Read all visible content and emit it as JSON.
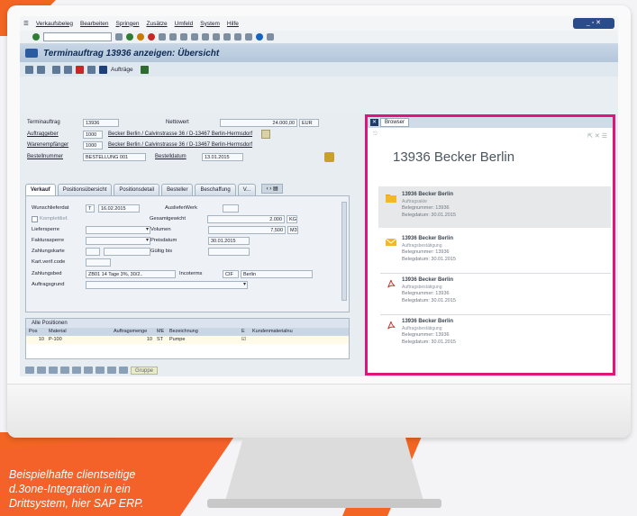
{
  "sap": {
    "menu": [
      "Verkaufsbeleg",
      "Bearbeiten",
      "Springen",
      "Zusätze",
      "Umfeld",
      "System",
      "Hilfe"
    ],
    "title": "Terminauftrag 13936 anzeigen: Übersicht",
    "toolbar2_label": "Aufträge",
    "header": {
      "terminauftrag_label": "Terminauftrag",
      "terminauftrag_value": "13936",
      "nettowert_label": "Nettowert",
      "nettowert_value": "24.000,00",
      "currency": "EUR",
      "auftraggeber_label": "Auftraggeber",
      "auftraggeber_value": "1000",
      "auftraggeber_addr": "Becker Berlin / Calvinstrasse 36 / D-13467 Berlin-Hermsdorf",
      "warenempfaenger_label": "Warenempfänger",
      "warenempfaenger_value": "1000",
      "warenempfaenger_addr": "Becker Berlin / Calvinstrasse 36 / D-13467 Berlin-Hermsdorf",
      "bestellnummer_label": "Bestellnummer",
      "bestellnummer_value": "BESTELLUNG 001",
      "bestelldatum_label": "Bestelldatum",
      "bestelldatum_value": "13.01.2015"
    },
    "tabs": [
      "Verkauf",
      "Positionsübersicht",
      "Positionsdetail",
      "Besteller",
      "Beschaffung",
      "V..."
    ],
    "fields": {
      "wunschlieferdat_label": "Wunschlieferdat",
      "wunschlieferdat_type": "T",
      "wunschlieferdat_value": "16.02.2015",
      "auslieferwerk_label": "AuslieferWerk",
      "komplettlief_label": "Komplettlief.",
      "gesamtgewicht_label": "Gesamtgewicht",
      "gesamtgewicht_value": "2.000",
      "gesamtgewicht_unit": "KG",
      "liefersperre_label": "Liefersperre",
      "volumen_label": "Volumen",
      "volumen_value": "7,500",
      "volumen_unit": "M3",
      "fakturasperre_label": "Fakturasperre",
      "preisdatum_label": "Preisdatum",
      "preisdatum_value": "30.01.2015",
      "zahlungskarte_label": "Zahlungskarte",
      "gueltig_bis_label": "Gültig bis",
      "kartverifcode_label": "Kart.verif.code",
      "zahlungsbed_label": "Zahlungsbed",
      "zahlungsbed_value": "ZB01 14 Tage 3%, 30/2..",
      "incoterms_label": "Incoterms",
      "incoterms_code": "CIF",
      "incoterms_place": "Berlin",
      "auftragsgrund_label": "Auftragsgrund"
    },
    "positions": {
      "title": "Alle Positionen",
      "columns": [
        "Pos",
        "Material",
        "Auftragsmenge",
        "ME",
        "Bezeichnung",
        "E",
        "Kundenmaterialnu"
      ],
      "rows": [
        {
          "pos": "10",
          "material": "P-100",
          "menge": "10",
          "me": "ST",
          "bezeichnung": "Pumpe"
        }
      ]
    },
    "bottom_button": "Gruppe"
  },
  "d3one": {
    "tab_label": "Browser",
    "heading": "13936 Becker Berlin",
    "items": [
      {
        "icon": "folder-icon",
        "title": "13936 Becker Berlin",
        "subtitle": "Auftragsakte",
        "belegnummer": "Belegnummer: 13936",
        "belegdatum": "Belegdatum: 30.01.2015"
      },
      {
        "icon": "mail-icon",
        "title": "13936 Becker Berlin",
        "subtitle": "Auftragsbestätigung",
        "belegnummer": "Belegnummer: 13936",
        "belegdatum": "Belegdatum: 30.01.2015"
      },
      {
        "icon": "pdf-icon",
        "title": "13936 Becker Berlin",
        "subtitle": "Auftragsbestätigung",
        "belegnummer": "Belegnummer: 13936",
        "belegdatum": "Belegdatum: 30.01.2015"
      },
      {
        "icon": "pdf-icon",
        "title": "13936 Becker Berlin",
        "subtitle": "Auftragsbestätigung",
        "belegnummer": "Belegnummer: 13936",
        "belegdatum": "Belegdatum: 30.01.2015"
      }
    ]
  },
  "caption": {
    "line1": "Beispielhafte clientseitige",
    "line2": "d.3one-Integration in ein",
    "line3": "Drittsystem, hier SAP ERP."
  },
  "colors": {
    "orange": "#f26522",
    "highlight": "#e0157b",
    "sap_title": "#0d2a55"
  }
}
